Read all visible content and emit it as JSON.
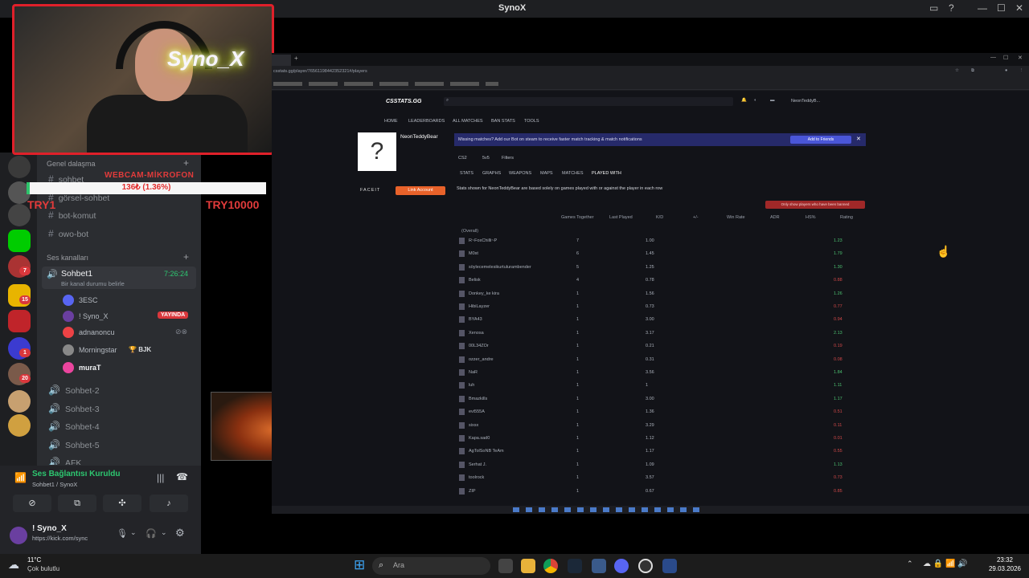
{
  "window": {
    "title": "SynoX"
  },
  "webcam": {
    "neon_text": "Syno_X"
  },
  "overlay": {
    "webcam_text": "WEBCAM-MİKROFON",
    "progress_text": "136₺ (1.36%)",
    "progress_fraction": 0.0136,
    "try_left": "TRY1",
    "try_right": "TRY10000"
  },
  "discord": {
    "categories": {
      "text": "Genel dalaşma",
      "voice": "Ses kanalları"
    },
    "text_channels": [
      "sohbet",
      "görsel-sohbet",
      "bot-komut",
      "owo-bot"
    ],
    "voice_channel": {
      "name": "Sohbet1",
      "timer": "7:26:24",
      "status": "Bir kanal durumu belirle"
    },
    "voice_users": [
      {
        "name": "3ESC",
        "live": false,
        "tag": ""
      },
      {
        "name": "! Syno_X",
        "live": true,
        "tag": "YAYINDA"
      },
      {
        "name": "adnanoncu",
        "live": false,
        "tag": ""
      },
      {
        "name": "Morningstar",
        "live": false,
        "tag": "BJK"
      },
      {
        "name": "muraT",
        "live": false,
        "tag": ""
      }
    ],
    "other_voice": [
      "Sohbet-2",
      "Sohbet-3",
      "Sohbet-4",
      "Sohbet-5",
      "AFK"
    ],
    "connection": {
      "status": "Ses Bağlantısı Kuruldu",
      "channel": "Sohbet1 / SynoX"
    },
    "user": {
      "name": "! Syno_X",
      "status": "https://kick.com/sync"
    },
    "server_badges": [
      "20",
      "7",
      "15",
      "1",
      "20"
    ]
  },
  "browser": {
    "url": "csstats.gg/player/76561198442352321#/players",
    "site": {
      "logo": "CSSTATS.GG",
      "nav": [
        "HOME",
        "LEADERBOARDS",
        "ALL MATCHES",
        "BAN STATS",
        "TOOLS"
      ],
      "account": "NeonTeddyB...",
      "player": "NeonTeddyBear",
      "faceit": "FACEIT",
      "link_button": "Link Account",
      "banner": "Missing matches? Add our Bot on steam to receive faster match tracking & match notifications",
      "add_friends": "Add to Friends",
      "filters": [
        "CS2",
        "5v5",
        "Filters"
      ],
      "tabs": [
        "STATS",
        "GRAPHS",
        "WEAPONS",
        "MAPS",
        "MATCHES",
        "PLAYED WITH"
      ],
      "note": "Stats shown for NeonTeddyBear are based solely on games played with or against the player in each row",
      "ban_button": "Only show players who have been banned",
      "columns": [
        "Games Together",
        "Last Played",
        "K/D",
        "+/-",
        "Win Rate",
        "ADR",
        "HS%",
        "Rating"
      ],
      "overall": "(Overall)",
      "rows": [
        {
          "name": "R~FoxChilli~P",
          "games": "7",
          "kd": "1.00",
          "rating": "1.23"
        },
        {
          "name": "M0st",
          "games": "6",
          "kd": "1.45",
          "rating": "1.79"
        },
        {
          "name": "söylecemelesikurtulurambender",
          "games": "5",
          "kd": "1.25",
          "rating": "1.30"
        },
        {
          "name": "Belisk",
          "games": "4",
          "kd": "0.78",
          "rating": "0.88"
        },
        {
          "name": "Donkey_ke kira",
          "games": "1",
          "kd": "1.56",
          "rating": "1.26"
        },
        {
          "name": "HibiLayzer",
          "games": "1",
          "kd": "0.73",
          "rating": "0.77"
        },
        {
          "name": "BYA43",
          "games": "1",
          "kd": "3.00",
          "rating": "0.94"
        },
        {
          "name": "Xenosa",
          "games": "1",
          "kd": "3.17",
          "rating": "2.13"
        },
        {
          "name": "00L34ZOr",
          "games": "1",
          "kd": "0.21",
          "rating": "0.19"
        },
        {
          "name": "ozzer_andre",
          "games": "1",
          "kd": "0.31",
          "rating": "0.08"
        },
        {
          "name": "NaR",
          "games": "1",
          "kd": "3.56",
          "rating": "1.84"
        },
        {
          "name": "luh",
          "games": "1",
          "kd": "1",
          "rating": "1.11"
        },
        {
          "name": "Bmazkills",
          "games": "1",
          "kd": "3.00",
          "rating": "1.17"
        },
        {
          "name": "evi555A",
          "games": "1",
          "kd": "1.36",
          "rating": "0.51"
        },
        {
          "name": "sixsx",
          "games": "1",
          "kd": "3.29",
          "rating": "0.11"
        },
        {
          "name": "Kapa.sad0",
          "games": "1",
          "kd": "1.12",
          "rating": "0.01"
        },
        {
          "name": "AgTolSoNB TeAm",
          "games": "1",
          "kd": "1.17",
          "rating": "0.55"
        },
        {
          "name": "Serhat J.",
          "games": "1",
          "kd": "1.09",
          "rating": "1.13"
        },
        {
          "name": "toolrock",
          "games": "1",
          "kd": "3.57",
          "rating": "0.73"
        },
        {
          "name": "ZIP",
          "games": "1",
          "kd": "0.67",
          "rating": "0.85"
        }
      ]
    }
  },
  "taskbar": {
    "weather_temp": "11°C",
    "weather_text": "Çok bulutlu",
    "search_placeholder": "Ara",
    "time": "23:32",
    "date": "29.03.2026"
  }
}
